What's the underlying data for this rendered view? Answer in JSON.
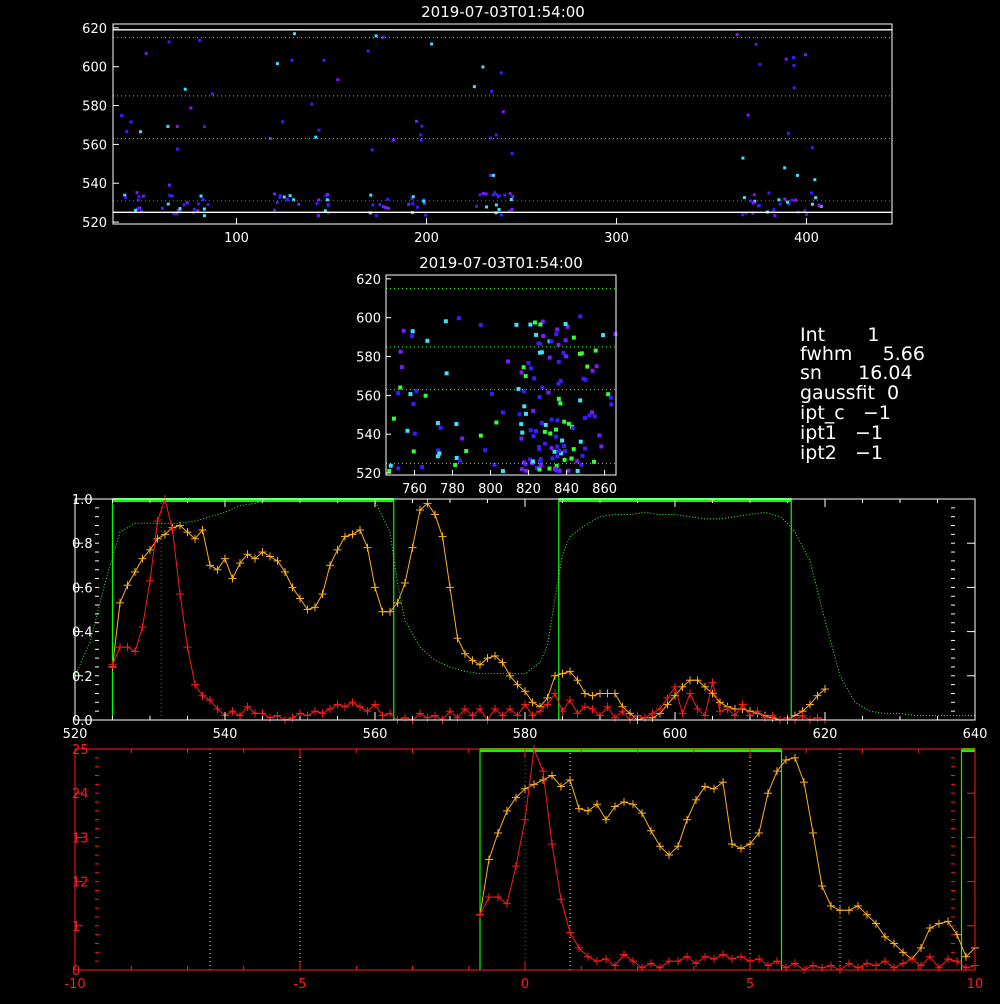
{
  "info": {
    "lines": [
      "Int       1",
      "fwhm     5.66",
      "sn      16.04",
      "gaussfit  0",
      "ipt_c   −1",
      "ipt1   −1",
      "ipt2   −1"
    ]
  },
  "colors": {
    "background": "#000000",
    "axis": "#ffffff",
    "green_marker": "#00ff00",
    "guide": "#33ff33",
    "red_line": "#ff1a1a",
    "orange_line": "#ffb020",
    "speckle_blue": "#3a1cff",
    "speckle_purple": "#7a1cff",
    "speckle_cyan": "#40e0ff"
  },
  "chart_data": [
    {
      "id": "top-image",
      "type": "heatmap",
      "title": "2019-07-03T01:54:00",
      "xlim": [
        35,
        445
      ],
      "ylim": [
        519,
        622
      ],
      "xticks": [
        100,
        200,
        300,
        400
      ],
      "yticks": [
        520,
        540,
        560,
        580,
        600,
        620
      ],
      "hlines_dotted": [
        {
          "y": 615,
          "color": "#33ff33"
        },
        {
          "y": 585,
          "color": "#33ff33"
        },
        {
          "y": 563,
          "color": "#33ff33"
        },
        {
          "y": 531,
          "color": "#ff3333"
        }
      ],
      "hlines_solid": [
        {
          "y": 619,
          "color": "#ffffff"
        },
        {
          "y": 525,
          "color": "#ffffff"
        }
      ],
      "cluster_columns": [
        45,
        65,
        80,
        125,
        145,
        175,
        195,
        232,
        240,
        370,
        385,
        400
      ]
    },
    {
      "id": "zoom-image",
      "type": "heatmap",
      "title": "2019-07-03T01:54:00",
      "xlim": [
        745,
        866
      ],
      "ylim": [
        519,
        622
      ],
      "xticks": [
        760,
        780,
        800,
        820,
        840,
        860
      ],
      "yticks": [
        520,
        540,
        560,
        580,
        600,
        620
      ],
      "hlines_dotted": [
        {
          "y": 615,
          "color": "#33ff33"
        },
        {
          "y": 585,
          "color": "#33ff33"
        },
        {
          "y": 563,
          "color": "#33ff33"
        },
        {
          "y": 525,
          "color": "#33ff33"
        }
      ]
    },
    {
      "id": "spectrum-wavelength",
      "type": "line",
      "xlim": [
        520,
        640
      ],
      "ylim": [
        0,
        1.0
      ],
      "xticks": [
        520,
        540,
        560,
        580,
        600,
        620,
        640
      ],
      "yticks_labels": [
        "0.0",
        "0.2",
        "0.4",
        "0.6",
        "0.8",
        "1.0"
      ],
      "yticks_values": [
        0.0,
        0.2,
        0.4,
        0.6,
        0.8,
        1.0
      ],
      "vlines_green": [
        525,
        562.5,
        584.5,
        615.5
      ],
      "green_bars": [
        [
          525,
          562.5
        ],
        [
          584.5,
          615.5
        ]
      ],
      "vline_red_dotted": 531.5,
      "series": [
        {
          "color": "#ffb020",
          "marker": "+",
          "x": [
            525,
            526,
            527,
            528,
            529,
            530,
            531,
            532,
            533,
            534,
            535,
            536,
            537,
            538,
            539,
            540,
            541,
            542,
            543,
            544,
            545,
            546,
            547,
            548,
            549,
            550,
            551,
            552,
            553,
            554,
            555,
            556,
            557,
            558,
            559,
            560,
            561,
            562,
            563,
            564,
            565,
            566,
            567,
            568,
            569,
            570,
            571,
            572,
            573,
            574,
            575,
            576,
            577,
            578,
            579,
            580,
            581,
            582,
            583,
            584,
            585,
            586,
            587,
            588,
            589,
            590,
            591,
            592,
            593,
            594,
            595,
            596,
            597,
            598,
            599,
            600,
            601,
            602,
            603,
            604,
            605,
            606,
            607,
            608,
            609,
            610,
            611,
            612,
            613,
            614,
            615,
            616,
            617,
            618,
            619,
            620
          ],
          "y": [
            0.24,
            0.53,
            0.61,
            0.67,
            0.73,
            0.77,
            0.82,
            0.84,
            0.87,
            0.88,
            0.85,
            0.82,
            0.86,
            0.7,
            0.68,
            0.73,
            0.64,
            0.71,
            0.75,
            0.73,
            0.76,
            0.74,
            0.72,
            0.67,
            0.6,
            0.55,
            0.5,
            0.51,
            0.57,
            0.7,
            0.77,
            0.83,
            0.84,
            0.86,
            0.78,
            0.6,
            0.49,
            0.49,
            0.53,
            0.62,
            0.78,
            0.95,
            0.98,
            0.93,
            0.83,
            0.6,
            0.37,
            0.3,
            0.27,
            0.25,
            0.28,
            0.29,
            0.26,
            0.2,
            0.16,
            0.13,
            0.08,
            0.06,
            0.1,
            0.2,
            0.21,
            0.22,
            0.18,
            0.12,
            0.11,
            0.12,
            0.12,
            0.12,
            0.06,
            0.03,
            0.0,
            0.01,
            0.01,
            0.03,
            0.07,
            0.11,
            0.15,
            0.18,
            0.18,
            0.15,
            0.12,
            0.08,
            0.06,
            0.05,
            0.05,
            0.04,
            0.03,
            0.02,
            0.01,
            0.0,
            0.0,
            0.02,
            0.04,
            0.07,
            0.11,
            0.14
          ]
        },
        {
          "color": "#ff1a1a",
          "marker": "+",
          "x": [
            525,
            526,
            527,
            528,
            529,
            530,
            531,
            532,
            533,
            534,
            535,
            536,
            537,
            538,
            539,
            540,
            541,
            542,
            543,
            544,
            545,
            546,
            547,
            548,
            549,
            550,
            551,
            552,
            553,
            554,
            555,
            556,
            557,
            558,
            559,
            560,
            561,
            562,
            563,
            564,
            565,
            566,
            567,
            568,
            569,
            570,
            571,
            572,
            573,
            574,
            575,
            576,
            577,
            578,
            579,
            580,
            581,
            582,
            583,
            584,
            585,
            586,
            587,
            588,
            589,
            590,
            591,
            592,
            593,
            594,
            595,
            596,
            597,
            598,
            599,
            600,
            601,
            602,
            603,
            604,
            605,
            606,
            607,
            608,
            609,
            610,
            611,
            612,
            613,
            614,
            615,
            616,
            617,
            618,
            619,
            620
          ],
          "y": [
            0.25,
            0.33,
            0.33,
            0.31,
            0.42,
            0.63,
            0.9,
            1.0,
            0.86,
            0.57,
            0.33,
            0.16,
            0.11,
            0.09,
            0.05,
            0.02,
            0.04,
            0.02,
            0.06,
            0.03,
            0.03,
            0.01,
            0.02,
            0.0,
            0.01,
            0.03,
            0.02,
            0.04,
            0.03,
            0.05,
            0.07,
            0.06,
            0.08,
            0.06,
            0.04,
            0.07,
            0.02,
            0.03,
            0.0,
            0.01,
            0.0,
            0.03,
            0.01,
            0.02,
            0.0,
            0.04,
            0.01,
            0.05,
            0.02,
            0.05,
            0.0,
            0.05,
            0.02,
            0.05,
            0.02,
            0.07,
            0.02,
            0.04,
            0.07,
            0.12,
            0.04,
            0.09,
            0.03,
            0.06,
            0.05,
            0.02,
            0.06,
            0.01,
            0.04,
            0.0,
            0.02,
            0.01,
            0.03,
            0.05,
            0.1,
            0.15,
            0.03,
            0.12,
            0.05,
            0.02,
            0.17,
            0.04,
            0.05,
            0.02,
            0.07,
            0.02,
            0.04,
            0.01,
            0.02,
            0.0,
            0.01,
            0.0,
            0.02,
            0.0,
            0.01,
            0.0
          ]
        },
        {
          "color": "#33ff33",
          "marker": "dotted",
          "x": [
            520,
            522,
            524,
            526,
            528,
            530,
            532,
            534,
            536,
            538,
            540,
            542,
            544,
            546,
            548,
            550,
            552,
            554,
            556,
            558,
            560,
            562,
            563,
            564,
            566,
            568,
            570,
            572,
            574,
            576,
            578,
            580,
            582,
            583,
            584,
            585,
            586,
            588,
            590,
            592,
            594,
            596,
            598,
            600,
            602,
            604,
            606,
            608,
            610,
            612,
            614,
            615,
            616,
            618,
            620,
            622,
            624,
            626,
            628,
            630,
            632,
            634,
            636,
            638,
            640
          ],
          "y": [
            0.2,
            0.35,
            0.62,
            0.85,
            0.89,
            0.89,
            0.89,
            0.89,
            0.9,
            0.92,
            0.94,
            0.97,
            0.98,
            1.0,
            1.0,
            0.99,
            0.99,
            1.0,
            0.99,
            0.99,
            0.99,
            0.85,
            0.62,
            0.45,
            0.33,
            0.27,
            0.24,
            0.22,
            0.21,
            0.21,
            0.21,
            0.21,
            0.26,
            0.34,
            0.55,
            0.75,
            0.83,
            0.88,
            0.92,
            0.93,
            0.93,
            0.94,
            0.93,
            0.93,
            0.92,
            0.91,
            0.91,
            0.92,
            0.93,
            0.94,
            0.92,
            0.89,
            0.85,
            0.72,
            0.45,
            0.2,
            0.08,
            0.04,
            0.03,
            0.03,
            0.02,
            0.02,
            0.02,
            0.02,
            0.02
          ]
        }
      ]
    },
    {
      "id": "spectrum-offset",
      "type": "line",
      "xlim": [
        -10,
        10
      ],
      "ylim": [
        0,
        1.0
      ],
      "xticks": [
        -10,
        -5,
        0,
        5,
        10
      ],
      "yticks_labels": [
        "0",
        "1",
        "12",
        "13",
        "24",
        "25"
      ],
      "yticks_values": [
        0.0,
        0.2,
        0.4,
        0.6,
        0.8,
        1.0
      ],
      "vlines_yellow_dotted": [
        -7,
        -5,
        5,
        7
      ],
      "vlines_white_dotted": [
        1
      ],
      "vlines_green": [
        -1,
        5.7,
        9.7
      ],
      "green_bars": [
        [
          -1,
          5.7
        ],
        [
          9.7,
          10
        ]
      ],
      "vline_red_dotted": 0,
      "series": [
        {
          "color": "#ffb020",
          "marker": "+",
          "x": [
            -1,
            -0.8,
            -0.6,
            -0.4,
            -0.2,
            0,
            0.2,
            0.4,
            0.6,
            0.8,
            1,
            1.2,
            1.4,
            1.6,
            1.8,
            2,
            2.2,
            2.4,
            2.6,
            2.8,
            3,
            3.2,
            3.4,
            3.6,
            3.8,
            4,
            4.2,
            4.4,
            4.6,
            4.8,
            5,
            5.2,
            5.4,
            5.6,
            5.8,
            6,
            6.2,
            6.4,
            6.6,
            6.8,
            7,
            7.2,
            7.4,
            7.6,
            7.8,
            8,
            8.2,
            8.4,
            8.6,
            8.8,
            9,
            9.2,
            9.4,
            9.6,
            9.8,
            10
          ],
          "y": [
            0.25,
            0.5,
            0.62,
            0.72,
            0.78,
            0.82,
            0.84,
            0.86,
            0.88,
            0.83,
            0.86,
            0.73,
            0.72,
            0.75,
            0.68,
            0.74,
            0.76,
            0.75,
            0.71,
            0.63,
            0.56,
            0.52,
            0.56,
            0.68,
            0.77,
            0.83,
            0.82,
            0.85,
            0.57,
            0.55,
            0.57,
            0.62,
            0.8,
            0.9,
            0.95,
            0.96,
            0.85,
            0.62,
            0.38,
            0.29,
            0.27,
            0.27,
            0.29,
            0.25,
            0.21,
            0.15,
            0.12,
            0.08,
            0.05,
            0.1,
            0.19,
            0.21,
            0.22,
            0.16,
            0.06,
            0.1
          ]
        },
        {
          "color": "#ff1a1a",
          "marker": "+",
          "x": [
            -1,
            -0.8,
            -0.6,
            -0.4,
            -0.2,
            0,
            0.2,
            0.4,
            0.6,
            0.8,
            1,
            1.2,
            1.4,
            1.6,
            1.8,
            2,
            2.2,
            2.4,
            2.6,
            2.8,
            3,
            3.2,
            3.4,
            3.6,
            3.8,
            4,
            4.2,
            4.4,
            4.6,
            4.8,
            5,
            5.2,
            5.4,
            5.6,
            5.8,
            6,
            6.2,
            6.4,
            6.6,
            6.8,
            7,
            7.2,
            7.4,
            7.6,
            7.8,
            8,
            8.2,
            8.4,
            8.6,
            8.8,
            9,
            9.2,
            9.4,
            9.6,
            9.8,
            10
          ],
          "y": [
            0.25,
            0.33,
            0.33,
            0.3,
            0.47,
            0.68,
            1.0,
            0.9,
            0.57,
            0.32,
            0.17,
            0.1,
            0.06,
            0.04,
            0.05,
            0.02,
            0.07,
            0.04,
            0.01,
            0.03,
            0.01,
            0.04,
            0.04,
            0.06,
            0.03,
            0.06,
            0.05,
            0.07,
            0.05,
            0.06,
            0.04,
            0.05,
            0.02,
            0.04,
            0.01,
            0.03,
            0.0,
            0.02,
            0.01,
            0.02,
            0.0,
            0.03,
            0.01,
            0.03,
            0.02,
            0.04,
            0.01,
            0.03,
            0.05,
            0.02,
            0.06,
            0.01,
            0.05,
            0.04,
            0.01,
            0.02
          ]
        }
      ]
    }
  ]
}
